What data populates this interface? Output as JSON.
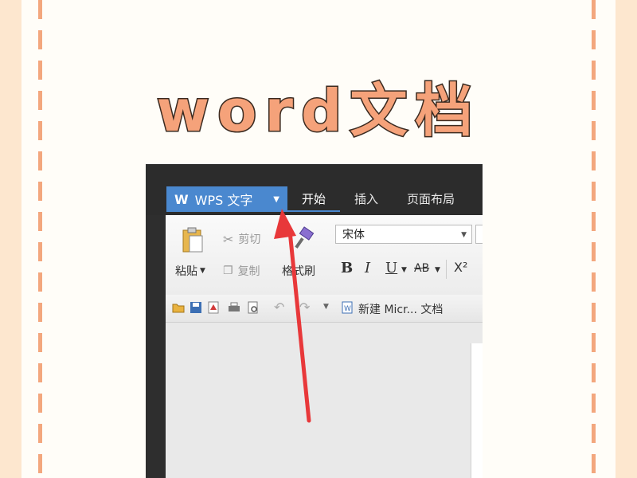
{
  "headline": "word文档",
  "app": {
    "menu_label": "WPS 文字",
    "tabs": [
      "开始",
      "插入",
      "页面布局"
    ]
  },
  "ribbon": {
    "paste": "粘贴",
    "cut": "剪切",
    "copy": "复制",
    "format_painter": "格式刷",
    "font_name": "宋体",
    "bold": "B",
    "italic": "I",
    "underline": "U",
    "strike": "AB",
    "superscript": "X²"
  },
  "quick_access": {
    "doc_tab": "新建 Micr... 文档"
  },
  "colors": {
    "accent": "#4a88cf",
    "arrow": "#e8383a",
    "headline_fill": "#f5a27a"
  }
}
